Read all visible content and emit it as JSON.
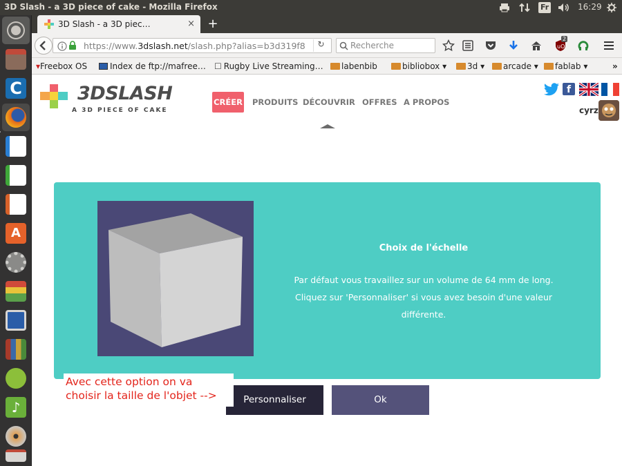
{
  "window": {
    "title": "3D Slash - a 3D piece of cake - Mozilla Firefox"
  },
  "system_tray": {
    "keyboard_layout": "Fr",
    "time": "16:29"
  },
  "launcher": {
    "items": [
      "dash-icon",
      "files-icon",
      "calibre-icon",
      "firefox-icon",
      "writer-icon",
      "calc-icon",
      "impress-icon",
      "software-center-icon",
      "system-settings-icon",
      "disk-usage-icon",
      "remote-desktop-icon",
      "library-icon",
      "android-icon",
      "music-tool-icon",
      "dvd-burner-icon",
      "printer-icon"
    ]
  },
  "browser": {
    "tab_title": "3D Slash - a 3D piec…",
    "tab_close": "×",
    "new_tab": "+",
    "url_domain_prefix": "https://www.",
    "url_domain": "3dslash.net",
    "url_path": "/slash.php?alias=b3d319f8",
    "search_placeholder": "Recherche",
    "ublock_count": "2",
    "bookmarks": [
      {
        "label": "Freebox OS",
        "type": "page"
      },
      {
        "label": "Index de ftp://mafree…",
        "type": "page"
      },
      {
        "label": "Rugby Live Streaming…",
        "type": "page"
      },
      {
        "label": "labenbib",
        "type": "folder"
      },
      {
        "label": "bibliobox",
        "type": "folder"
      },
      {
        "label": "3d",
        "type": "folder"
      },
      {
        "label": "arcade",
        "type": "folder"
      },
      {
        "label": "fablab",
        "type": "folder"
      }
    ],
    "bookmarks_overflow": "»"
  },
  "site": {
    "logo_text": "3DSLASH",
    "logo_tagline": "A 3D PIECE OF CAKE",
    "nav": [
      "CRÉER",
      "PRODUITS",
      "DÉCOUVRIR",
      "OFFRES",
      "A PROPOS"
    ],
    "active_nav_color": "#f0606c",
    "user_name": "cyrz"
  },
  "modal": {
    "title": "Choix de l'échelle",
    "body": "Par défaut vous travaillez sur un volume de 64 mm de long. Cliquez sur 'Personnaliser' si vous avez besoin d'une valeur différente.",
    "background": "#4ecdc4",
    "buttons": {
      "customize": "Personnaliser",
      "ok": "Ok"
    }
  },
  "annotation": {
    "text": "Avec cette option on va\nchoisir la taille de l'objet -->",
    "color": "#e3241b"
  }
}
